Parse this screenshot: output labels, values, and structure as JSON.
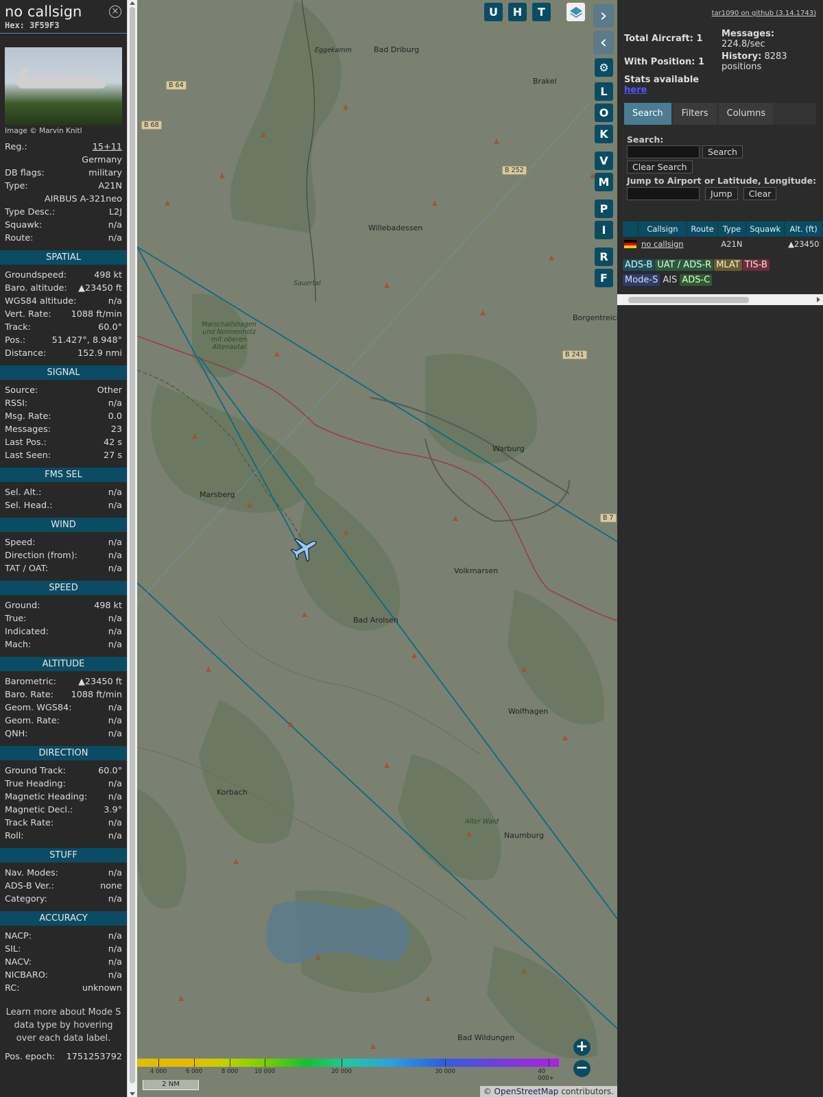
{
  "aircraft": {
    "callsign": "no callsign",
    "hex": "Hex: 3F59F3",
    "image_credit": "Image © Marvin Knitl",
    "details": [
      {
        "label": "Reg.:",
        "value": "15+11",
        "link": true
      },
      {
        "label": "",
        "value": "Germany"
      },
      {
        "label": "DB flags:",
        "value": "military"
      },
      {
        "label": "Type:",
        "value": "A21N"
      },
      {
        "label": "",
        "value": "AIRBUS A-321neo"
      },
      {
        "label": "Type Desc.:",
        "value": "L2J"
      },
      {
        "label": "Squawk:",
        "value": "n/a"
      },
      {
        "label": "Route:",
        "value": "n/a"
      }
    ]
  },
  "sections": [
    {
      "title": "SPATIAL",
      "rows": [
        {
          "label": "Groundspeed:",
          "value": "498 kt"
        },
        {
          "label": "Baro. altitude:",
          "value": "▲23450 ft"
        },
        {
          "label": "WGS84 altitude:",
          "value": "n/a"
        },
        {
          "label": "Vert. Rate:",
          "value": "1088 ft/min"
        },
        {
          "label": "Track:",
          "value": "60.0°"
        },
        {
          "label": "Pos.:",
          "value": "51.427°, 8.948°"
        },
        {
          "label": "Distance:",
          "value": "152.9 nmi"
        }
      ]
    },
    {
      "title": "SIGNAL",
      "rows": [
        {
          "label": "Source:",
          "value": "Other"
        },
        {
          "label": "RSSI:",
          "value": "n/a"
        },
        {
          "label": "Msg. Rate:",
          "value": "0.0"
        },
        {
          "label": "Messages:",
          "value": "23"
        },
        {
          "label": "Last Pos.:",
          "value": "42 s"
        },
        {
          "label": "Last Seen:",
          "value": "27 s"
        }
      ]
    },
    {
      "title": "FMS SEL",
      "rows": [
        {
          "label": "Sel. Alt.:",
          "value": "n/a"
        },
        {
          "label": "Sel. Head.:",
          "value": "n/a"
        }
      ]
    },
    {
      "title": "WIND",
      "rows": [
        {
          "label": "Speed:",
          "value": "n/a"
        },
        {
          "label": "Direction (from):",
          "value": "n/a"
        },
        {
          "label": "TAT / OAT:",
          "value": "n/a"
        }
      ]
    },
    {
      "title": "SPEED",
      "rows": [
        {
          "label": "Ground:",
          "value": "498 kt"
        },
        {
          "label": "True:",
          "value": "n/a"
        },
        {
          "label": "Indicated:",
          "value": "n/a"
        },
        {
          "label": "Mach:",
          "value": "n/a"
        }
      ]
    },
    {
      "title": "ALTITUDE",
      "rows": [
        {
          "label": "Barometric:",
          "value": "▲23450 ft"
        },
        {
          "label": "Baro. Rate:",
          "value": "1088 ft/min"
        },
        {
          "label": "Geom. WGS84:",
          "value": "n/a"
        },
        {
          "label": "Geom. Rate:",
          "value": "n/a"
        },
        {
          "label": "QNH:",
          "value": "n/a"
        }
      ]
    },
    {
      "title": "DIRECTION",
      "rows": [
        {
          "label": "Ground Track:",
          "value": "60.0°"
        },
        {
          "label": "True Heading:",
          "value": "n/a"
        },
        {
          "label": "Magnetic Heading:",
          "value": "n/a"
        },
        {
          "label": "Magnetic Decl.:",
          "value": "3.9°"
        },
        {
          "label": "Track Rate:",
          "value": "n/a"
        },
        {
          "label": "Roll:",
          "value": "n/a"
        }
      ]
    },
    {
      "title": "STUFF",
      "rows": [
        {
          "label": "Nav. Modes:",
          "value": "n/a"
        },
        {
          "label": "ADS-B Ver.:",
          "value": "none"
        },
        {
          "label": "Category:",
          "value": "n/a"
        }
      ]
    },
    {
      "title": "ACCURACY",
      "rows": [
        {
          "label": "NACP:",
          "value": "n/a"
        },
        {
          "label": "SIL:",
          "value": "n/a"
        },
        {
          "label": "NACV:",
          "value": "n/a"
        },
        {
          "label": "NICBARO:",
          "value": "n/a"
        },
        {
          "label": "RC:",
          "value": "unknown"
        }
      ]
    }
  ],
  "footnote": "Learn more about Mode S data type by hovering over each data label.",
  "pos_epoch": {
    "label": "Pos. epoch:",
    "value": "1751253792"
  },
  "map": {
    "buttons": [
      "U",
      "H",
      "T"
    ],
    "side_buttons": [
      "L",
      "O",
      "K",
      "V",
      "M",
      "P",
      "I",
      "R",
      "F"
    ],
    "towns": [
      "Bad Driburg",
      "Brakel",
      "Willebadessen",
      "Borgentreich",
      "Warburg",
      "Marsberg",
      "Volkmarsen",
      "Bad Arolsen",
      "Wolfhagen",
      "Korbach",
      "Naumburg",
      "Bad Wildungen",
      "Eggekamm"
    ],
    "roads": [
      "B 64",
      "B 68",
      "B 252",
      "B 241",
      "B 7"
    ],
    "areas": [
      "Sauertal",
      "Marschallshagen und Nonnenholz mit oberen Altenautal",
      "Alter Wald"
    ],
    "legend_ticks": [
      "4 000",
      "6 000",
      "8 000",
      "10 000",
      "20 000",
      "30 000",
      "40 000+"
    ],
    "scale": "2 NM",
    "attribution_prefix": "© ",
    "attribution_link": "OpenStreetMap",
    "attribution_suffix": " contributors.",
    "zoom_in": "+",
    "zoom_out": "−"
  },
  "panel": {
    "github": "tar1090 on github (3.14.1743)",
    "total_aircraft": "Total Aircraft: 1",
    "with_position": "With Position: 1",
    "stats_available": "Stats available",
    "here": "here",
    "messages_label": "Messages:",
    "messages_value": "224.8/sec",
    "history_label": "History:",
    "history_value": "8283 positions",
    "tabs": [
      "Search",
      "Filters",
      "Columns"
    ],
    "search_label": "Search:",
    "search_btn": "Search",
    "clear_search_btn": "Clear Search",
    "jump_label": "Jump to Airport or Latitude, Longitude:",
    "jump_btn": "Jump",
    "clear_btn": "Clear",
    "columns": [
      "",
      "Callsign",
      "Route",
      "Type",
      "Squawk",
      "Alt. (ft)"
    ],
    "row": {
      "callsign": "no callsign",
      "route": "",
      "type": "A21N",
      "squawk": "",
      "alt": "▲23450"
    },
    "sources": [
      {
        "name": "ADS-B",
        "bg": "#1f4d5e",
        "fg": "#cfe"
      },
      {
        "name": "UAT / ADS-R",
        "bg": "#2d5a3a",
        "fg": "#dfd"
      },
      {
        "name": "MLAT",
        "bg": "#6b5a2e",
        "fg": "#eed"
      },
      {
        "name": "TIS-B",
        "bg": "#6a2e3c",
        "fg": "#fdd"
      },
      {
        "name": "Mode-S",
        "bg": "#2d3d6b",
        "fg": "#dde"
      },
      {
        "name": "AIS",
        "bg": "transparent",
        "fg": "#ddd"
      },
      {
        "name": "ADS-C",
        "bg": "#2f5a2f",
        "fg": "#dfd"
      }
    ]
  }
}
